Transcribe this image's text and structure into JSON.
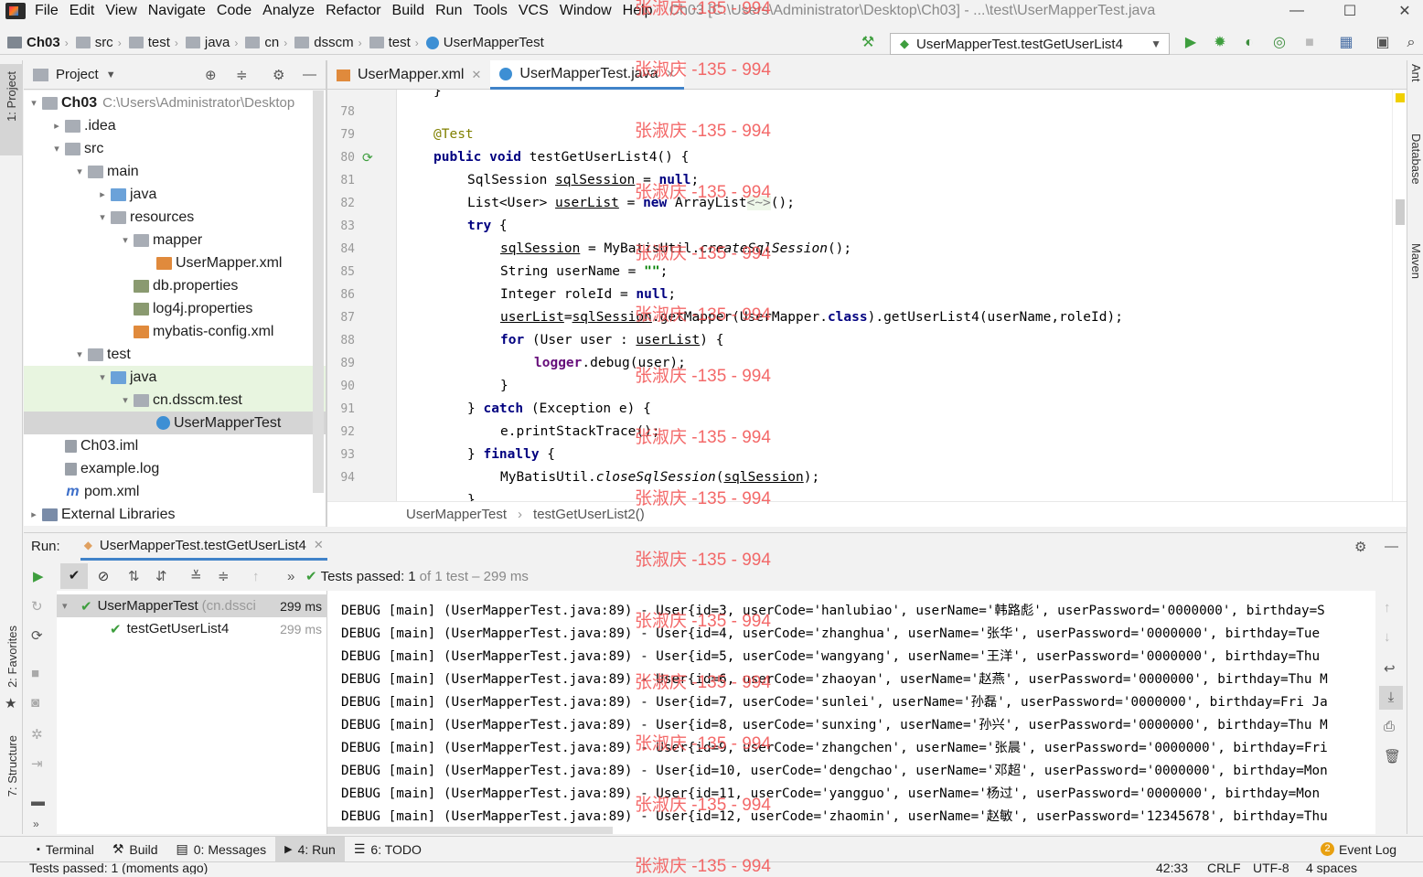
{
  "menu": {
    "items": [
      "File",
      "Edit",
      "View",
      "Navigate",
      "Code",
      "Analyze",
      "Refactor",
      "Build",
      "Run",
      "Tools",
      "VCS",
      "Window",
      "Help"
    ],
    "title": "Ch03 [C:\\Users\\Administrator\\Desktop\\Ch03] - ...\\test\\UserMapperTest.java"
  },
  "nav": {
    "crumbs": [
      "Ch03",
      "src",
      "test",
      "java",
      "cn",
      "dsscm",
      "test",
      "UserMapperTest"
    ],
    "run_config": "UserMapperTest.testGetUserList4"
  },
  "project": {
    "title": "Project",
    "tree": [
      {
        "label": "Ch03",
        "extra": "C:\\Users\\Administrator\\Desktop",
        "indent": 0,
        "arrow": "▾",
        "icon": "folder",
        "bold": true
      },
      {
        "label": ".idea",
        "indent": 1,
        "arrow": "▸",
        "icon": "folder"
      },
      {
        "label": "src",
        "indent": 1,
        "arrow": "▾",
        "icon": "folder"
      },
      {
        "label": "main",
        "indent": 2,
        "arrow": "▾",
        "icon": "folder"
      },
      {
        "label": "java",
        "indent": 3,
        "arrow": "▸",
        "icon": "jfolder"
      },
      {
        "label": "resources",
        "indent": 3,
        "arrow": "▾",
        "icon": "folder"
      },
      {
        "label": "mapper",
        "indent": 4,
        "arrow": "▾",
        "icon": "folder"
      },
      {
        "label": "UserMapper.xml",
        "indent": 5,
        "arrow": "",
        "icon": "xml"
      },
      {
        "label": "db.properties",
        "indent": 4,
        "arrow": "",
        "icon": "prop"
      },
      {
        "label": "log4j.properties",
        "indent": 4,
        "arrow": "",
        "icon": "prop"
      },
      {
        "label": "mybatis-config.xml",
        "indent": 4,
        "arrow": "",
        "icon": "xml"
      },
      {
        "label": "test",
        "indent": 2,
        "arrow": "▾",
        "icon": "folder"
      },
      {
        "label": "java",
        "indent": 3,
        "arrow": "▾",
        "icon": "jfolder",
        "hl": true
      },
      {
        "label": "cn.dsscm.test",
        "indent": 4,
        "arrow": "▾",
        "icon": "folder",
        "hl": true
      },
      {
        "label": "UserMapperTest",
        "indent": 5,
        "arrow": "",
        "icon": "cls",
        "sel": true
      },
      {
        "label": "Ch03.iml",
        "indent": 1,
        "arrow": "",
        "icon": "file"
      },
      {
        "label": "example.log",
        "indent": 1,
        "arrow": "",
        "icon": "file"
      },
      {
        "label": "pom.xml",
        "indent": 1,
        "arrow": "",
        "icon": "mvn"
      },
      {
        "label": "External Libraries",
        "indent": 0,
        "arrow": "▸",
        "icon": "lib"
      }
    ]
  },
  "tabs": [
    {
      "label": "UserMapper.xml",
      "active": false
    },
    {
      "label": "UserMapperTest.java",
      "active": true
    }
  ],
  "editor": {
    "first_line": 78,
    "line_numbers": [
      "78",
      "79",
      "80",
      "81",
      "82",
      "83",
      "84",
      "85",
      "86",
      "87",
      "88",
      "89",
      "90",
      "91",
      "92",
      "93",
      "94"
    ]
  },
  "breadcrumb": {
    "class": "UserMapperTest",
    "method": "testGetUserList2()"
  },
  "run": {
    "label": "Run:",
    "tab": "UserMapperTest.testGetUserList4",
    "status_prefix": "Tests passed:",
    "status_count": "1",
    "status_suffix": "of 1 test – 299 ms",
    "tests": [
      {
        "name": "UserMapperTest",
        "pkg": "(cn.dssci",
        "time": "299 ms"
      },
      {
        "name": "testGetUserList4",
        "time": "299 ms"
      }
    ]
  },
  "console": [
    "DEBUG [main] (UserMapperTest.java:89) - User{id=3, userCode='hanlubiao', userName='韩路彪', userPassword='0000000', birthday=S",
    "DEBUG [main] (UserMapperTest.java:89) - User{id=4, userCode='zhanghua', userName='张华', userPassword='0000000', birthday=Tue",
    "DEBUG [main] (UserMapperTest.java:89) - User{id=5, userCode='wangyang', userName='王洋', userPassword='0000000', birthday=Thu",
    "DEBUG [main] (UserMapperTest.java:89) - User{id=6, userCode='zhaoyan', userName='赵燕', userPassword='0000000', birthday=Thu M",
    "DEBUG [main] (UserMapperTest.java:89) - User{id=7, userCode='sunlei', userName='孙磊', userPassword='0000000', birthday=Fri Ja",
    "DEBUG [main] (UserMapperTest.java:89) - User{id=8, userCode='sunxing', userName='孙兴', userPassword='0000000', birthday=Thu M",
    "DEBUG [main] (UserMapperTest.java:89) - User{id=9, userCode='zhangchen', userName='张晨', userPassword='0000000', birthday=Fri",
    "DEBUG [main] (UserMapperTest.java:89) - User{id=10, userCode='dengchao', userName='邓超', userPassword='0000000', birthday=Mon",
    "DEBUG [main] (UserMapperTest.java:89) - User{id=11, userCode='yangguo', userName='杨过', userPassword='0000000', birthday=Mon",
    "DEBUG [main] (UserMapperTest.java:89) - User{id=12, userCode='zhaomin', userName='赵敏', userPassword='12345678', birthday=Thu"
  ],
  "bottom": {
    "tools": [
      "Terminal",
      "Build",
      "0: Messages",
      "4: Run",
      "6: TODO"
    ],
    "event_badge": "2",
    "event_log": "Event Log"
  },
  "status": {
    "text": "Tests passed: 1 (moments ago)",
    "pos": "42:33",
    "eol": "CRLF",
    "enc": "UTF-8",
    "indent": "4 spaces"
  },
  "side": {
    "left": [
      "1: Project",
      "2: Favorites",
      "7: Structure"
    ],
    "right": [
      "Ant",
      "Database",
      "Maven"
    ]
  },
  "watermark": "张淑庆 -135 - 994"
}
